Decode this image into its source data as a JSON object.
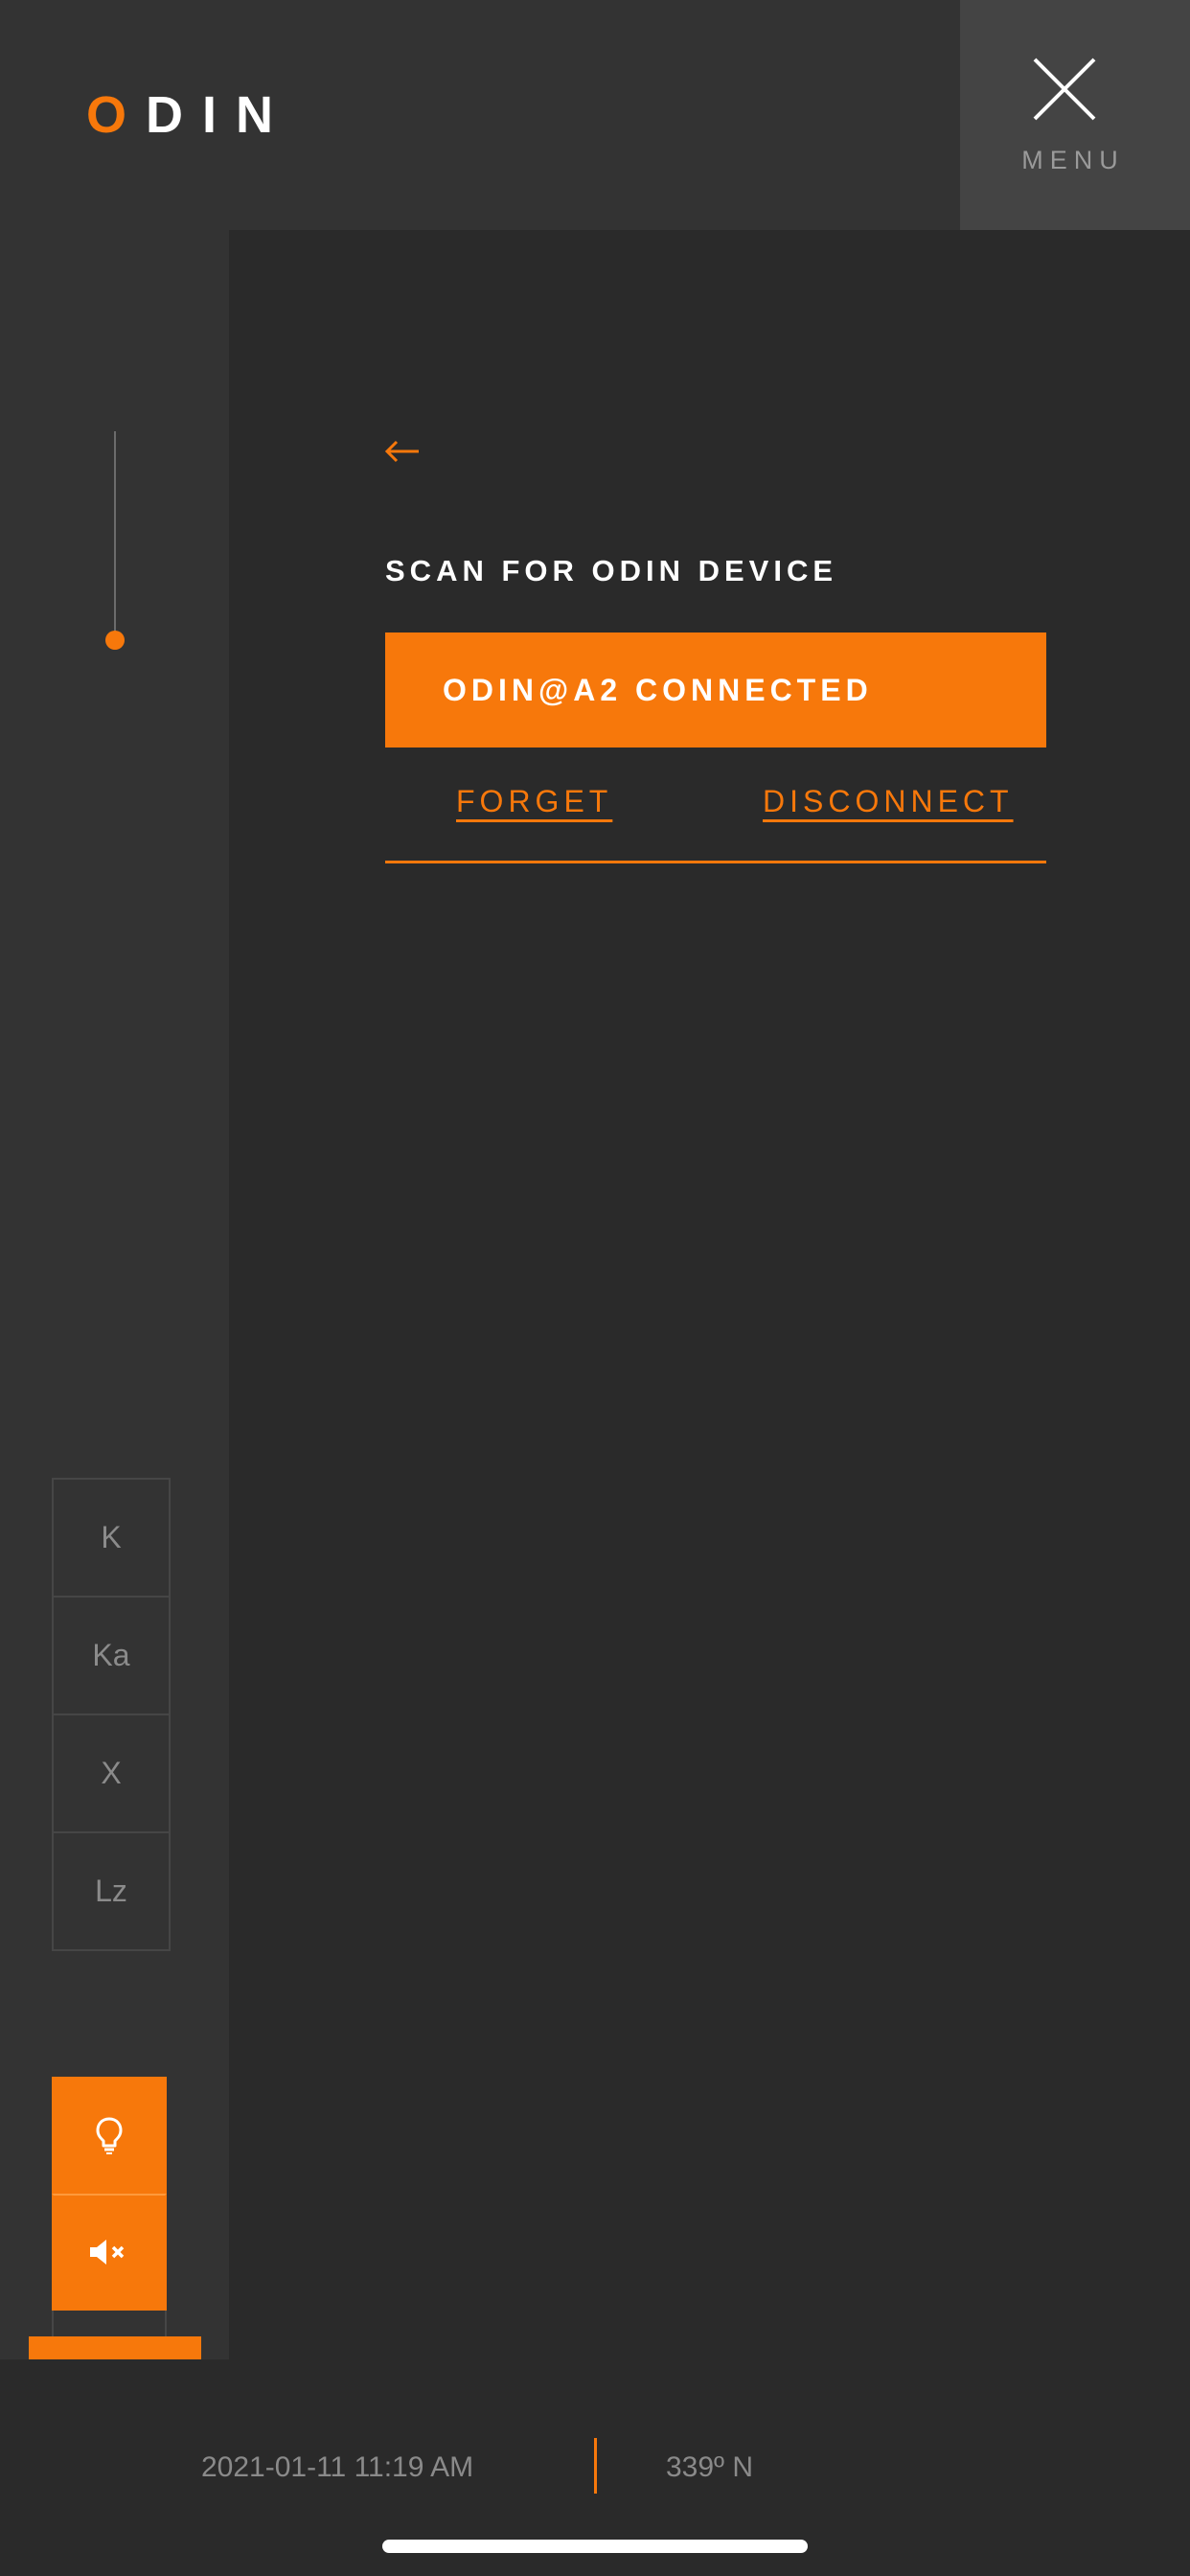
{
  "app": {
    "logo_first_letter": "O",
    "logo_rest": "DIN"
  },
  "menu": {
    "label": "MENU",
    "icon": "close-icon"
  },
  "sidebar": {
    "bands": [
      {
        "label": "K"
      },
      {
        "label": "Ka"
      },
      {
        "label": "X"
      },
      {
        "label": "Lz"
      }
    ],
    "tools": [
      {
        "icon": "lightbulb-icon",
        "active": true
      },
      {
        "icon": "mute-icon",
        "active": true
      },
      {
        "icon": "city-icon",
        "active": false
      },
      {
        "icon": "shield-icon",
        "active": false
      }
    ],
    "slider_level": 1.0
  },
  "main": {
    "back_icon": "back-arrow-icon",
    "title": "SCAN FOR ODIN DEVICE",
    "device_status": "ODIN@A2 CONNECTED",
    "forget_label": "FORGET",
    "disconnect_label": "DISCONNECT"
  },
  "footer": {
    "datetime": "2021-01-11 11:19 AM",
    "heading": "339º N"
  },
  "colors": {
    "accent": "#f7780b",
    "background": "#2a2a2a",
    "panel": "#333333",
    "menu_tile": "#444444",
    "muted_text": "#8a8a8a"
  }
}
